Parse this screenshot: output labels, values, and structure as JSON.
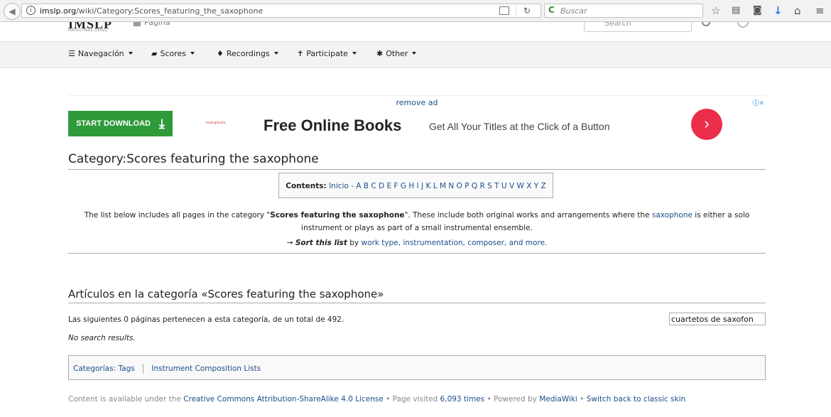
{
  "browser": {
    "url_domain": "imslp.org",
    "url_path": "/wiki/Category:Scores_featuring_the_saxophone",
    "search_placeholder": "Buscar"
  },
  "site": {
    "logo_sub": "Petrucci Music Library",
    "nav": [
      {
        "icon": "menu-icon",
        "label": "Navegación"
      },
      {
        "icon": "book-icon",
        "label": "Scores"
      },
      {
        "icon": "microphone-icon",
        "label": "Recordings"
      },
      {
        "icon": "person-icon",
        "label": "Participate"
      },
      {
        "icon": "asterisk-icon",
        "label": "Other"
      }
    ]
  },
  "ad": {
    "remove_ad": "remove ad",
    "download_label": "START DOWNLOAD",
    "brand": "readingfanatic",
    "title": "Free Online Books",
    "description": "Get All Your Titles at the Click of a Button"
  },
  "page": {
    "title": "Category:Scores featuring the saxophone",
    "contents_label": "Contents:",
    "contents_home": "Inicio",
    "contents_sep": " - ",
    "letters": [
      "A",
      "B",
      "C",
      "D",
      "E",
      "F",
      "G",
      "H",
      "I",
      "J",
      "K",
      "L",
      "M",
      "N",
      "O",
      "P",
      "Q",
      "R",
      "S",
      "T",
      "U",
      "V",
      "W",
      "X",
      "Y",
      "Z"
    ],
    "desc_before": "The list below includes all pages in the category \"",
    "desc_bold": "Scores featuring the saxophone",
    "desc_middle": "\". These include both original works and arrangements where the ",
    "desc_link": "saxophone",
    "desc_line1_end": " is either a solo",
    "desc_line2": "instrument or plays as part of a small instrumental ensemble.",
    "sort_arrow": "→ ",
    "sort_bold": "Sort this list",
    "sort_by": " by ",
    "sort_link": "work type, instrumentation, composer, and more",
    "sort_end": ".",
    "articles_heading": "Artículos en la categoría «Scores featuring the saxophone»",
    "count_text": "Las siguientes 0 páginas pertenecen a esta categoría, de un total de 492.",
    "filter_value": "cuartetos de saxofon",
    "no_results": "No search results.",
    "categories_label": "Categorías:",
    "categories": [
      "Tags",
      "Instrument Composition Lists"
    ]
  },
  "footer": {
    "t1": "Content is available under the ",
    "license": "Creative Commons Attribution-ShareAlike 4.0 License",
    "t2": " • Page visited ",
    "visits": "6,093 times",
    "t3": " • Powered by ",
    "mediawiki": "MediaWiki",
    "t4": " • ",
    "classic": "Switch back to classic skin"
  }
}
